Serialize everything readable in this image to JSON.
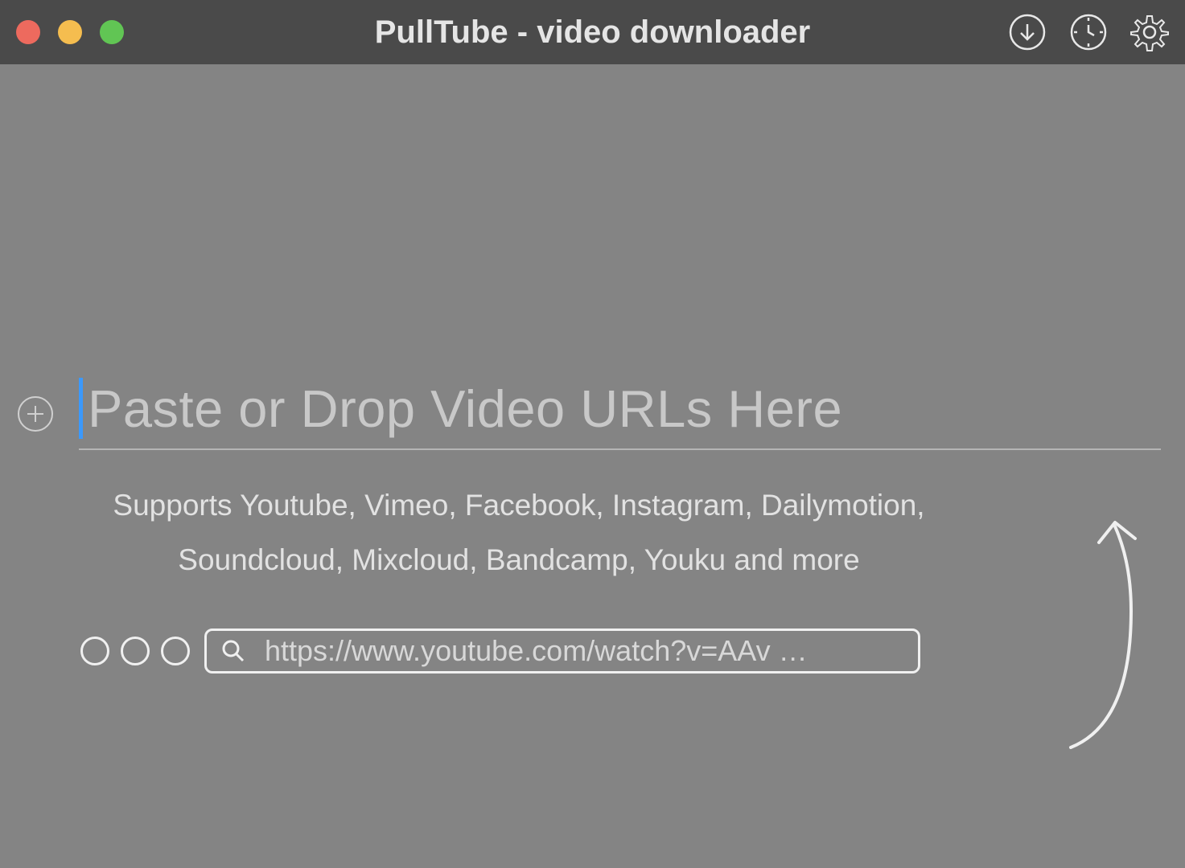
{
  "titlebar": {
    "title": "PullTube - video downloader"
  },
  "main": {
    "url_placeholder": "Paste or Drop Video URLs Here",
    "supports_text": "Supports Youtube, Vimeo, Facebook, Instagram, Dailymotion, Soundcloud, Mixcloud, Bandcamp, Youku and more",
    "example_url": "https://www.youtube.com/watch?v=AAv …"
  }
}
